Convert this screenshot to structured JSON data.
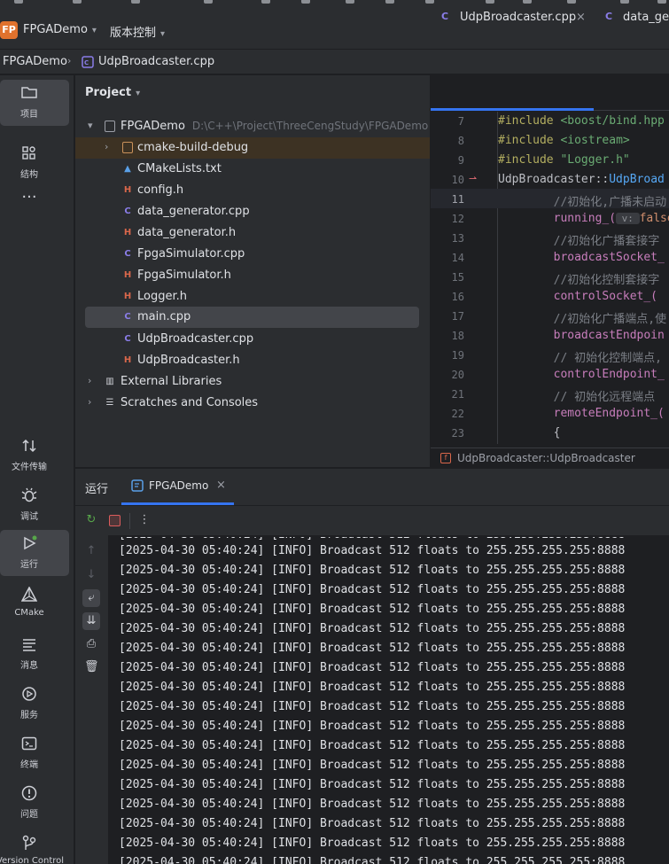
{
  "app": {
    "logo": "FP",
    "project_name": "FPGADemo",
    "vcs_menu": "版本控制"
  },
  "breadcrumb": [
    "FPGADemo",
    "UdpBroadcaster.cpp"
  ],
  "left_toolbar": [
    {
      "icon": "folder-icon",
      "label": "项目"
    },
    {
      "icon": "structure-icon",
      "label": "结构"
    },
    {
      "icon": "more-icon",
      "label": ""
    },
    {
      "icon": "file-transfer-icon",
      "label": "文件传输"
    },
    {
      "icon": "debug-icon",
      "label": "调试"
    },
    {
      "icon": "run-icon",
      "label": "运行"
    },
    {
      "icon": "cmake-icon",
      "label": "CMake"
    },
    {
      "icon": "messages-icon",
      "label": "消息"
    },
    {
      "icon": "services-icon",
      "label": "服务"
    },
    {
      "icon": "terminal-icon",
      "label": "终端"
    },
    {
      "icon": "problems-icon",
      "label": "问题"
    },
    {
      "icon": "version-control-icon",
      "label": "Version Control"
    }
  ],
  "project_panel": {
    "title": "Project",
    "root": {
      "name": "FPGADemo",
      "path": "D:\\C++\\Project\\ThreeCengStudy\\FPGADemo"
    },
    "items": [
      {
        "name": "cmake-build-debug",
        "kind": "folder"
      },
      {
        "name": "CMakeLists.txt",
        "kind": "cmake"
      },
      {
        "name": "config.h",
        "kind": "header"
      },
      {
        "name": "data_generator.cpp",
        "kind": "cpp"
      },
      {
        "name": "data_generator.h",
        "kind": "header"
      },
      {
        "name": "FpgaSimulator.cpp",
        "kind": "cpp"
      },
      {
        "name": "FpgaSimulator.h",
        "kind": "header"
      },
      {
        "name": "Logger.h",
        "kind": "header"
      },
      {
        "name": "main.cpp",
        "kind": "cpp"
      },
      {
        "name": "UdpBroadcaster.cpp",
        "kind": "cpp"
      },
      {
        "name": "UdpBroadcaster.h",
        "kind": "header"
      }
    ],
    "external_libraries": "External Libraries",
    "scratches": "Scratches and Consoles"
  },
  "editor": {
    "tabs": [
      {
        "label": "UdpBroadcaster.cpp",
        "active": true
      },
      {
        "label": "data_gen"
      }
    ],
    "lines": [
      {
        "no": "7",
        "segs": [
          {
            "t": "#include ",
            "c": "#b3ae60"
          },
          {
            "t": "<boost/bind.hpp",
            "c": "#6aab73"
          }
        ]
      },
      {
        "no": "8",
        "segs": [
          {
            "t": "#include ",
            "c": "#b3ae60"
          },
          {
            "t": "<iostream>",
            "c": "#6aab73"
          }
        ]
      },
      {
        "no": "9",
        "segs": [
          {
            "t": "#include ",
            "c": "#b3ae60"
          },
          {
            "t": "\"Logger.h\"",
            "c": "#6aab73"
          }
        ]
      },
      {
        "no": "10",
        "segs": [
          {
            "t": "UdpBroadcaster::",
            "c": "#bcbec4"
          },
          {
            "t": "UdpBroad",
            "c": "#56a8f5"
          }
        ]
      },
      {
        "no": "11",
        "segs": [
          {
            "t": "        //初始化,广播未启动",
            "c": "#7a7e85"
          }
        ]
      },
      {
        "no": "12",
        "segs": [
          {
            "t": "        running_(",
            "c": "#c77dbb"
          },
          {
            "t": " v: ",
            "c": "#8c8f94"
          },
          {
            "t": "false",
            "c": "#cf8e6d"
          }
        ]
      },
      {
        "no": "13",
        "segs": [
          {
            "t": "        //初始化广播套接字",
            "c": "#7a7e85"
          }
        ]
      },
      {
        "no": "14",
        "segs": [
          {
            "t": "        broadcastSocket_",
            "c": "#c77dbb"
          }
        ]
      },
      {
        "no": "15",
        "segs": [
          {
            "t": "        //初始化控制套接字",
            "c": "#7a7e85"
          }
        ]
      },
      {
        "no": "16",
        "segs": [
          {
            "t": "        controlSocket_(",
            "c": "#c77dbb"
          }
        ]
      },
      {
        "no": "17",
        "segs": [
          {
            "t": "        //初始化广播端点,使",
            "c": "#7a7e85"
          }
        ]
      },
      {
        "no": "18",
        "segs": [
          {
            "t": "        broadcastEndpoin",
            "c": "#c77dbb"
          }
        ]
      },
      {
        "no": "19",
        "segs": [
          {
            "t": "        // 初始化控制端点,",
            "c": "#7a7e85"
          }
        ]
      },
      {
        "no": "20",
        "segs": [
          {
            "t": "        controlEndpoint_",
            "c": "#c77dbb"
          }
        ]
      },
      {
        "no": "21",
        "segs": [
          {
            "t": "        // 初始化远程端点",
            "c": "#7a7e85"
          }
        ]
      },
      {
        "no": "22",
        "segs": [
          {
            "t": "        remoteEndpoint_(",
            "c": "#c77dbb"
          }
        ]
      },
      {
        "no": "23",
        "segs": [
          {
            "t": "        {",
            "c": "#bcbec4"
          }
        ]
      }
    ],
    "current_line": "11",
    "status_context": "UdpBroadcaster::UdpBroadcaster"
  },
  "run_panel": {
    "title": "运行",
    "tab_label": "FPGADemo",
    "log_line": "[2025-04-30 05:40:24] [INFO] Broadcast 512 floats to 255.255.255.255:8888",
    "log_count": 17
  }
}
